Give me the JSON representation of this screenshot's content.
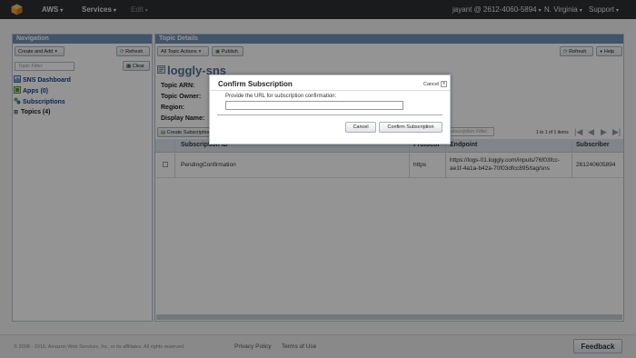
{
  "topnav": {
    "brand": "AWS",
    "services": "Services",
    "edit": "Edit",
    "account": "jayant @ 2612-4060-5894",
    "region": "N. Virginia",
    "support": "Support",
    "caret": "▾"
  },
  "navigation": {
    "title": "Navigation",
    "create_add": "Create and Add",
    "refresh": "Refresh",
    "filter_placeholder": "Topic Filter",
    "clear": "Clear",
    "items": [
      {
        "label": "SNS Dashboard"
      },
      {
        "label": "Apps (0)"
      },
      {
        "label": "Subscriptions"
      },
      {
        "label": "Topics (4)"
      }
    ]
  },
  "topic_details": {
    "title": "Topic Details",
    "topic_actions": "All Topic Actions",
    "publish": "Publish",
    "refresh": "Refresh",
    "help": "Help",
    "topic_name": "loggly-sns",
    "fields": [
      "Topic ARN:",
      "Topic Owner:",
      "Region:",
      "Display Name:"
    ],
    "create_subscription": "Create Subscription",
    "sub_filter_placeholder": "Subscription Filter",
    "pagination": "1 to 1 of 1 items"
  },
  "subscriptions_table": {
    "columns": [
      "Subscription ID",
      "Protocol",
      "Endpoint",
      "Subscriber"
    ],
    "rows": [
      {
        "subscription_id": "PendingConfirmation",
        "protocol": "https",
        "endpoint_line1": "https://logs-01.loggly.com/inputs/76f03fcc-",
        "endpoint_line2": "ae1f-4a1a-b42a-70f03dfcc895/tag/sns",
        "subscriber": "261240605894"
      }
    ]
  },
  "modal": {
    "title": "Confirm Subscription",
    "cancel_link": "Cancel",
    "close": "x",
    "prompt": "Provide the URL for subscription confirmation:",
    "url_value": "",
    "cancel_button": "Cancel",
    "confirm_button": "Confirm Subscription"
  },
  "footer": {
    "copyright": "© 2008 - 2016, Amazon Web Services, Inc. or its affiliates. All rights reserved.",
    "privacy": "Privacy Policy",
    "terms": "Terms of Use",
    "feedback": "Feedback"
  },
  "colors": {
    "topbar": "#2d2f33",
    "panel_header": "#6f92b8",
    "link": "#1c3f87",
    "aws_logo": "#f0a33a"
  }
}
